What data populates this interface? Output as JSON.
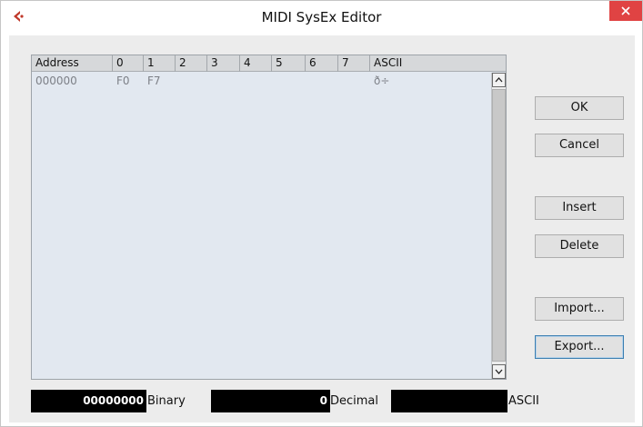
{
  "window": {
    "title": "MIDI SysEx Editor"
  },
  "table": {
    "headers": [
      "Address",
      "0",
      "1",
      "2",
      "3",
      "4",
      "5",
      "6",
      "7",
      "ASCII"
    ],
    "rows": [
      {
        "address": "000000",
        "b0": "F0",
        "b1": "F7",
        "ascii": "ð÷"
      }
    ]
  },
  "buttons": {
    "ok": "OK",
    "cancel": "Cancel",
    "insert": "Insert",
    "delete": "Delete",
    "import": "Import...",
    "export": "Export..."
  },
  "fields": {
    "binary_value": "00000000",
    "binary_label": "Binary",
    "decimal_value": "0",
    "decimal_label": "Decimal",
    "ascii_value": "",
    "ascii_label": "ASCII"
  },
  "colors": {
    "close": "#e04343",
    "accent_icon": "#c0392b"
  },
  "icons": {
    "app": "cubase-logo-icon",
    "close": "close-icon",
    "scroll_up": "arrow-up-icon",
    "scroll_down": "arrow-down-icon"
  }
}
